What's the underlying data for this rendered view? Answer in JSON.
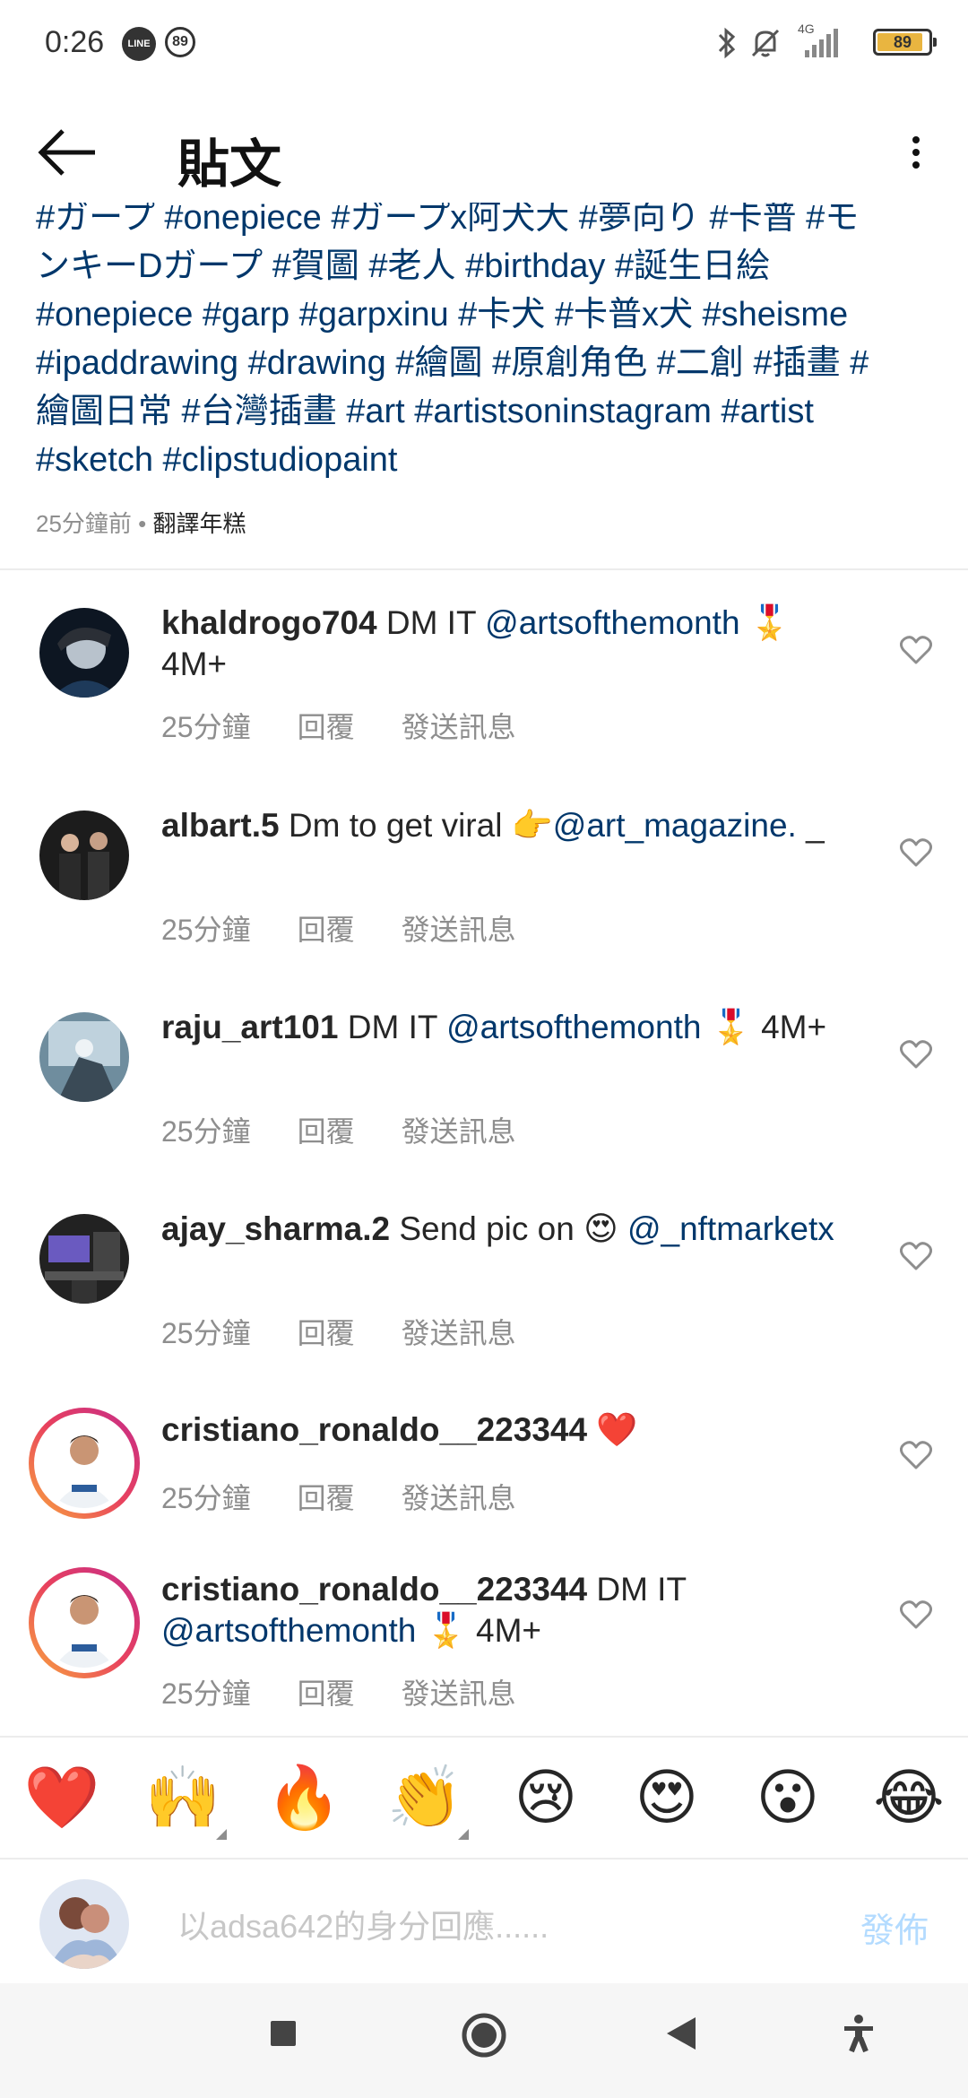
{
  "status_bar": {
    "time": "0:26",
    "line_badge": "LINE",
    "notif_count": "89",
    "network": "4G",
    "battery": "89",
    "battery_level": 0.89
  },
  "header": {
    "title": "貼文",
    "back_icon": "arrow-left-icon",
    "more_icon": "more-vertical-icon"
  },
  "caption": {
    "lines": [
      "#ガープ #onepiece #ガープx阿犬大 #夢向り #卡普 #モ",
      "ンキーDガープ #賀圖 #老人 #birthday #誕生日絵",
      "#onepiece #garp #garpxinu #卡犬 #卡普x犬  #sheisme",
      "#ipaddrawing #drawing #繪圖 #原創角色 #二創 #插畫 #",
      "繪圖日常  #台灣插畫 #art #artistsoninstagram #artist",
      "#sketch #clipstudiopaint"
    ],
    "time": "25分鐘前",
    "separator": "•",
    "translate": "翻譯年糕"
  },
  "comments": [
    {
      "user": "khaldrogo704",
      "text": " DM IT ",
      "mention": "@artsofthemonth",
      "suffix": " 🎖️ 4M+",
      "time": "25分鐘",
      "reply": "回覆",
      "message": "發送訊息"
    },
    {
      "user": "albart.5",
      "text": " Dm to get viral 👉",
      "mention": "@art_magazine.",
      "suffix": " _",
      "time": "25分鐘",
      "reply": "回覆",
      "message": "發送訊息"
    },
    {
      "user": "raju_art101",
      "text": " DM IT ",
      "mention": "@artsofthemonth",
      "suffix": " 🎖️ 4M+",
      "time": "25分鐘",
      "reply": "回覆",
      "message": "發送訊息"
    },
    {
      "user": "ajay_sharma.2",
      "text": " Send pic on 😍 ",
      "mention": "@_nftmarketx",
      "suffix": "",
      "time": "25分鐘",
      "reply": "回覆",
      "message": "發送訊息"
    },
    {
      "user": "cristiano_ronaldo__223344",
      "text": " ❤️",
      "mention": "",
      "suffix": "",
      "time": "25分鐘",
      "reply": "回覆",
      "message": "發送訊息"
    },
    {
      "user": "cristiano_ronaldo__223344",
      "text": " DM IT ",
      "mention": "@artsofthemonth",
      "suffix": " 🎖️ 4M+",
      "time": "25分鐘",
      "reply": "回覆",
      "message": "發送訊息"
    }
  ],
  "emoji_bar": [
    "❤️",
    "🙌",
    "🔥",
    "👏",
    "😢",
    "😍",
    "😮",
    "😂"
  ],
  "reply_bar": {
    "placeholder": "以adsa642的身分回應......",
    "post_label": "發佈"
  },
  "navbar": {
    "icons": [
      "recents-square-icon",
      "home-circle-icon",
      "back-triangle-icon",
      "accessibility-icon"
    ]
  },
  "colors": {
    "link": "#00376b",
    "muted": "#8e8e8e",
    "post_disabled": "#b3dbff",
    "story_ring_start": "#f9a93d",
    "story_ring_end": "#c52c8a"
  }
}
